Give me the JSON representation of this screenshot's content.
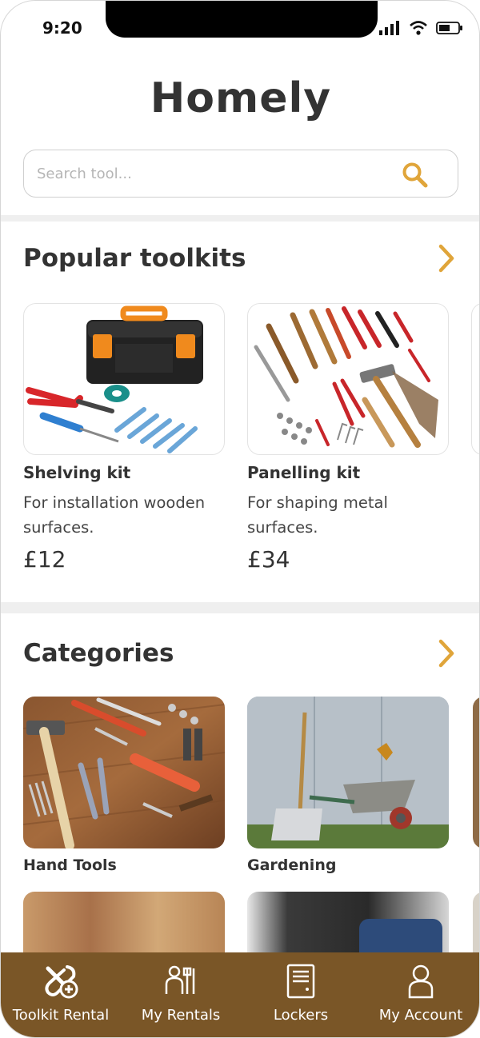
{
  "status_bar": {
    "time": "9:20"
  },
  "app": {
    "logo": "Homely"
  },
  "search": {
    "placeholder": "Search tool..."
  },
  "popular": {
    "title": "Popular toolkits",
    "items": [
      {
        "name": "Shelving kit",
        "description": "For installation wooden surfaces.",
        "price": "£12"
      },
      {
        "name": "Panelling kit",
        "description": "For shaping metal surfaces.",
        "price": "£34"
      }
    ]
  },
  "categories": {
    "title": "Categories",
    "items": [
      {
        "name": "Hand Tools"
      },
      {
        "name": "Gardening"
      }
    ]
  },
  "bottom_nav": {
    "items": [
      {
        "label": "Toolkit Rental",
        "icon": "tools-plus-icon"
      },
      {
        "label": "My Rentals",
        "icon": "rentals-icon"
      },
      {
        "label": "Lockers",
        "icon": "locker-icon"
      },
      {
        "label": "My Account",
        "icon": "user-icon"
      }
    ]
  },
  "colors": {
    "accent": "#e0a53a",
    "nav_bg": "#7a5627",
    "text": "#333333"
  }
}
